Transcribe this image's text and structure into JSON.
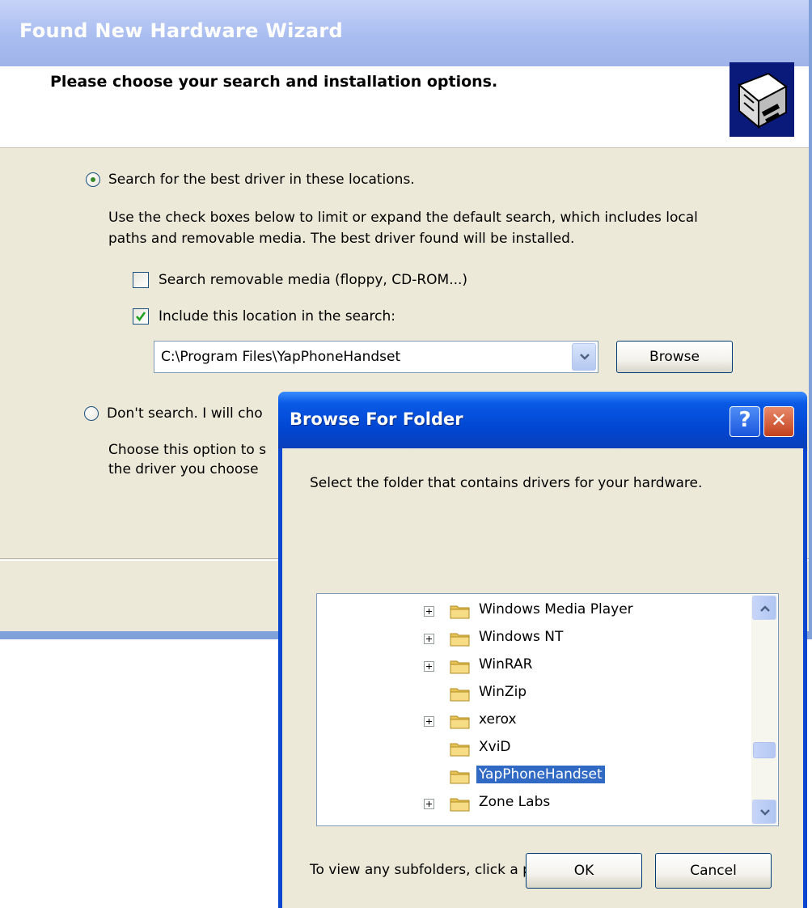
{
  "wizard": {
    "title": "Found New Hardware Wizard",
    "heading": "Please choose your search and installation options.",
    "option_search_label": "Search for the best driver in these locations.",
    "option_search_desc_line1": "Use the check boxes below to limit or expand the default search, which includes local",
    "option_search_desc_line2": "paths and removable media. The best driver found will be installed.",
    "check_removable_label": "Search removable media (floppy, CD-ROM...)",
    "check_removable_checked": false,
    "check_include_label": "Include this location in the search:",
    "check_include_checked": true,
    "location_value": "C:\\Program Files\\YapPhoneHandset",
    "browse_label": "Browse",
    "option_dont_search_label": "Don't search. I will cho",
    "option_dont_search_desc_line1": "Choose this option to s",
    "option_dont_search_desc_line2": "the driver you choose"
  },
  "browse_dialog": {
    "title": "Browse For Folder",
    "help_glyph": "?",
    "close_glyph": "✕",
    "instruction": "Select the folder that contains drivers for your hardware.",
    "tree_items": [
      {
        "label": "Windows Media Player",
        "expandable": true,
        "selected": false
      },
      {
        "label": "Windows NT",
        "expandable": true,
        "selected": false
      },
      {
        "label": "WinRAR",
        "expandable": true,
        "selected": false
      },
      {
        "label": "WinZip",
        "expandable": false,
        "selected": false
      },
      {
        "label": "xerox",
        "expandable": true,
        "selected": false
      },
      {
        "label": "XviD",
        "expandable": false,
        "selected": false
      },
      {
        "label": "YapPhoneHandset",
        "expandable": false,
        "selected": true
      },
      {
        "label": "Zone Labs",
        "expandable": true,
        "selected": false
      }
    ],
    "hint": "To view any subfolders, click a plus sign above.",
    "ok_label": "OK",
    "cancel_label": "Cancel"
  },
  "colors": {
    "dialog_title_blue": "#0046d2",
    "selection_blue": "#316ac5",
    "window_face": "#ece9d8"
  }
}
